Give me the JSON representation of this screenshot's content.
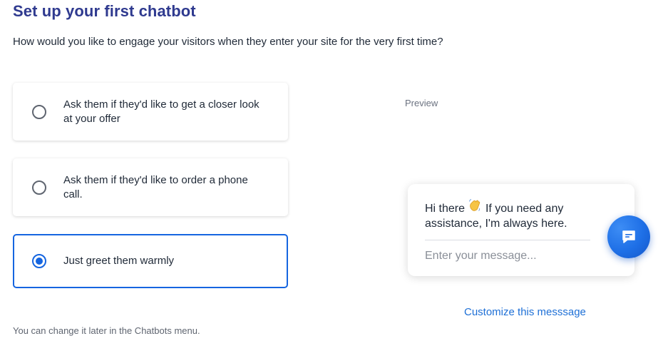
{
  "header": {
    "title": "Set up your first chatbot",
    "subtitle": "How would you like to engage your visitors when they enter your site for the very first time?"
  },
  "options": [
    {
      "label": "Ask them if they'd like to get a closer look at your offer",
      "selected": false
    },
    {
      "label": "Ask them if they'd like to order a phone call.",
      "selected": false
    },
    {
      "label": "Just greet them warmly",
      "selected": true
    }
  ],
  "preview": {
    "label": "Preview",
    "greeting_before": "Hi there",
    "greeting_icon": "waving-hand-icon",
    "greeting_after": "If you need any assistance, I'm always here.",
    "input_placeholder": "Enter your message...",
    "launcher_icon": "chat-bubble-icon",
    "customize_link": "Customize this messsage"
  },
  "footer": {
    "note": "You can change it later in the Chatbots menu."
  },
  "colors": {
    "title": "#2f3a8f",
    "accent": "#1565e0",
    "link": "#1d6fd6"
  }
}
